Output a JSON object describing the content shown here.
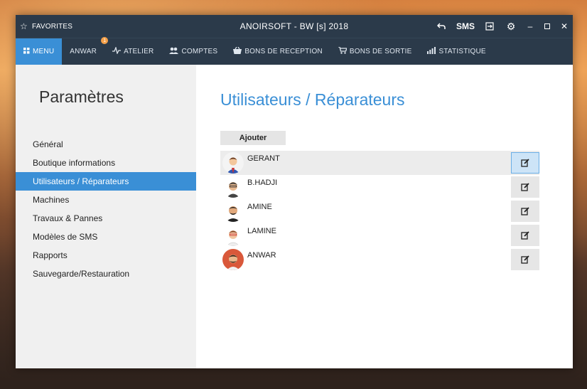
{
  "titlebar": {
    "favorites_label": "FAVORITES",
    "title": "ANOIRSOFT - BW [s] 2018",
    "sms_label": "SMS"
  },
  "menu": {
    "items": [
      {
        "label": "MENU",
        "icon": "grid-icon"
      },
      {
        "label": "ANWAR",
        "icon": "",
        "badge": "1"
      },
      {
        "label": "ATELIER",
        "icon": "pulse-icon"
      },
      {
        "label": "COMPTES",
        "icon": "users-icon"
      },
      {
        "label": "BONS DE RECEPTION",
        "icon": "basket-icon"
      },
      {
        "label": "BONS DE SORTIE",
        "icon": "cart-icon"
      },
      {
        "label": "STATISTIQUE",
        "icon": "bar-chart-icon"
      }
    ]
  },
  "sidebar": {
    "title": "Paramètres",
    "items": [
      {
        "label": "Général"
      },
      {
        "label": "Boutique informations"
      },
      {
        "label": "Utilisateurs / Réparateurs"
      },
      {
        "label": "Machines"
      },
      {
        "label": "Travaux & Pannes"
      },
      {
        "label": "Modèles de SMS"
      },
      {
        "label": "Rapports"
      },
      {
        "label": "Sauvegarde/Restauration"
      }
    ]
  },
  "main": {
    "title": "Utilisateurs / Réparateurs",
    "add_label": "Ajouter",
    "users": [
      {
        "name": "GERANT"
      },
      {
        "name": "B.HADJI"
      },
      {
        "name": "AMINE"
      },
      {
        "name": "LAMINE"
      },
      {
        "name": "ANWAR"
      }
    ]
  },
  "colors": {
    "accent": "#3a8fd6",
    "titlebar": "#2b3a4a",
    "sidebar_bg": "#f0f0f0"
  }
}
